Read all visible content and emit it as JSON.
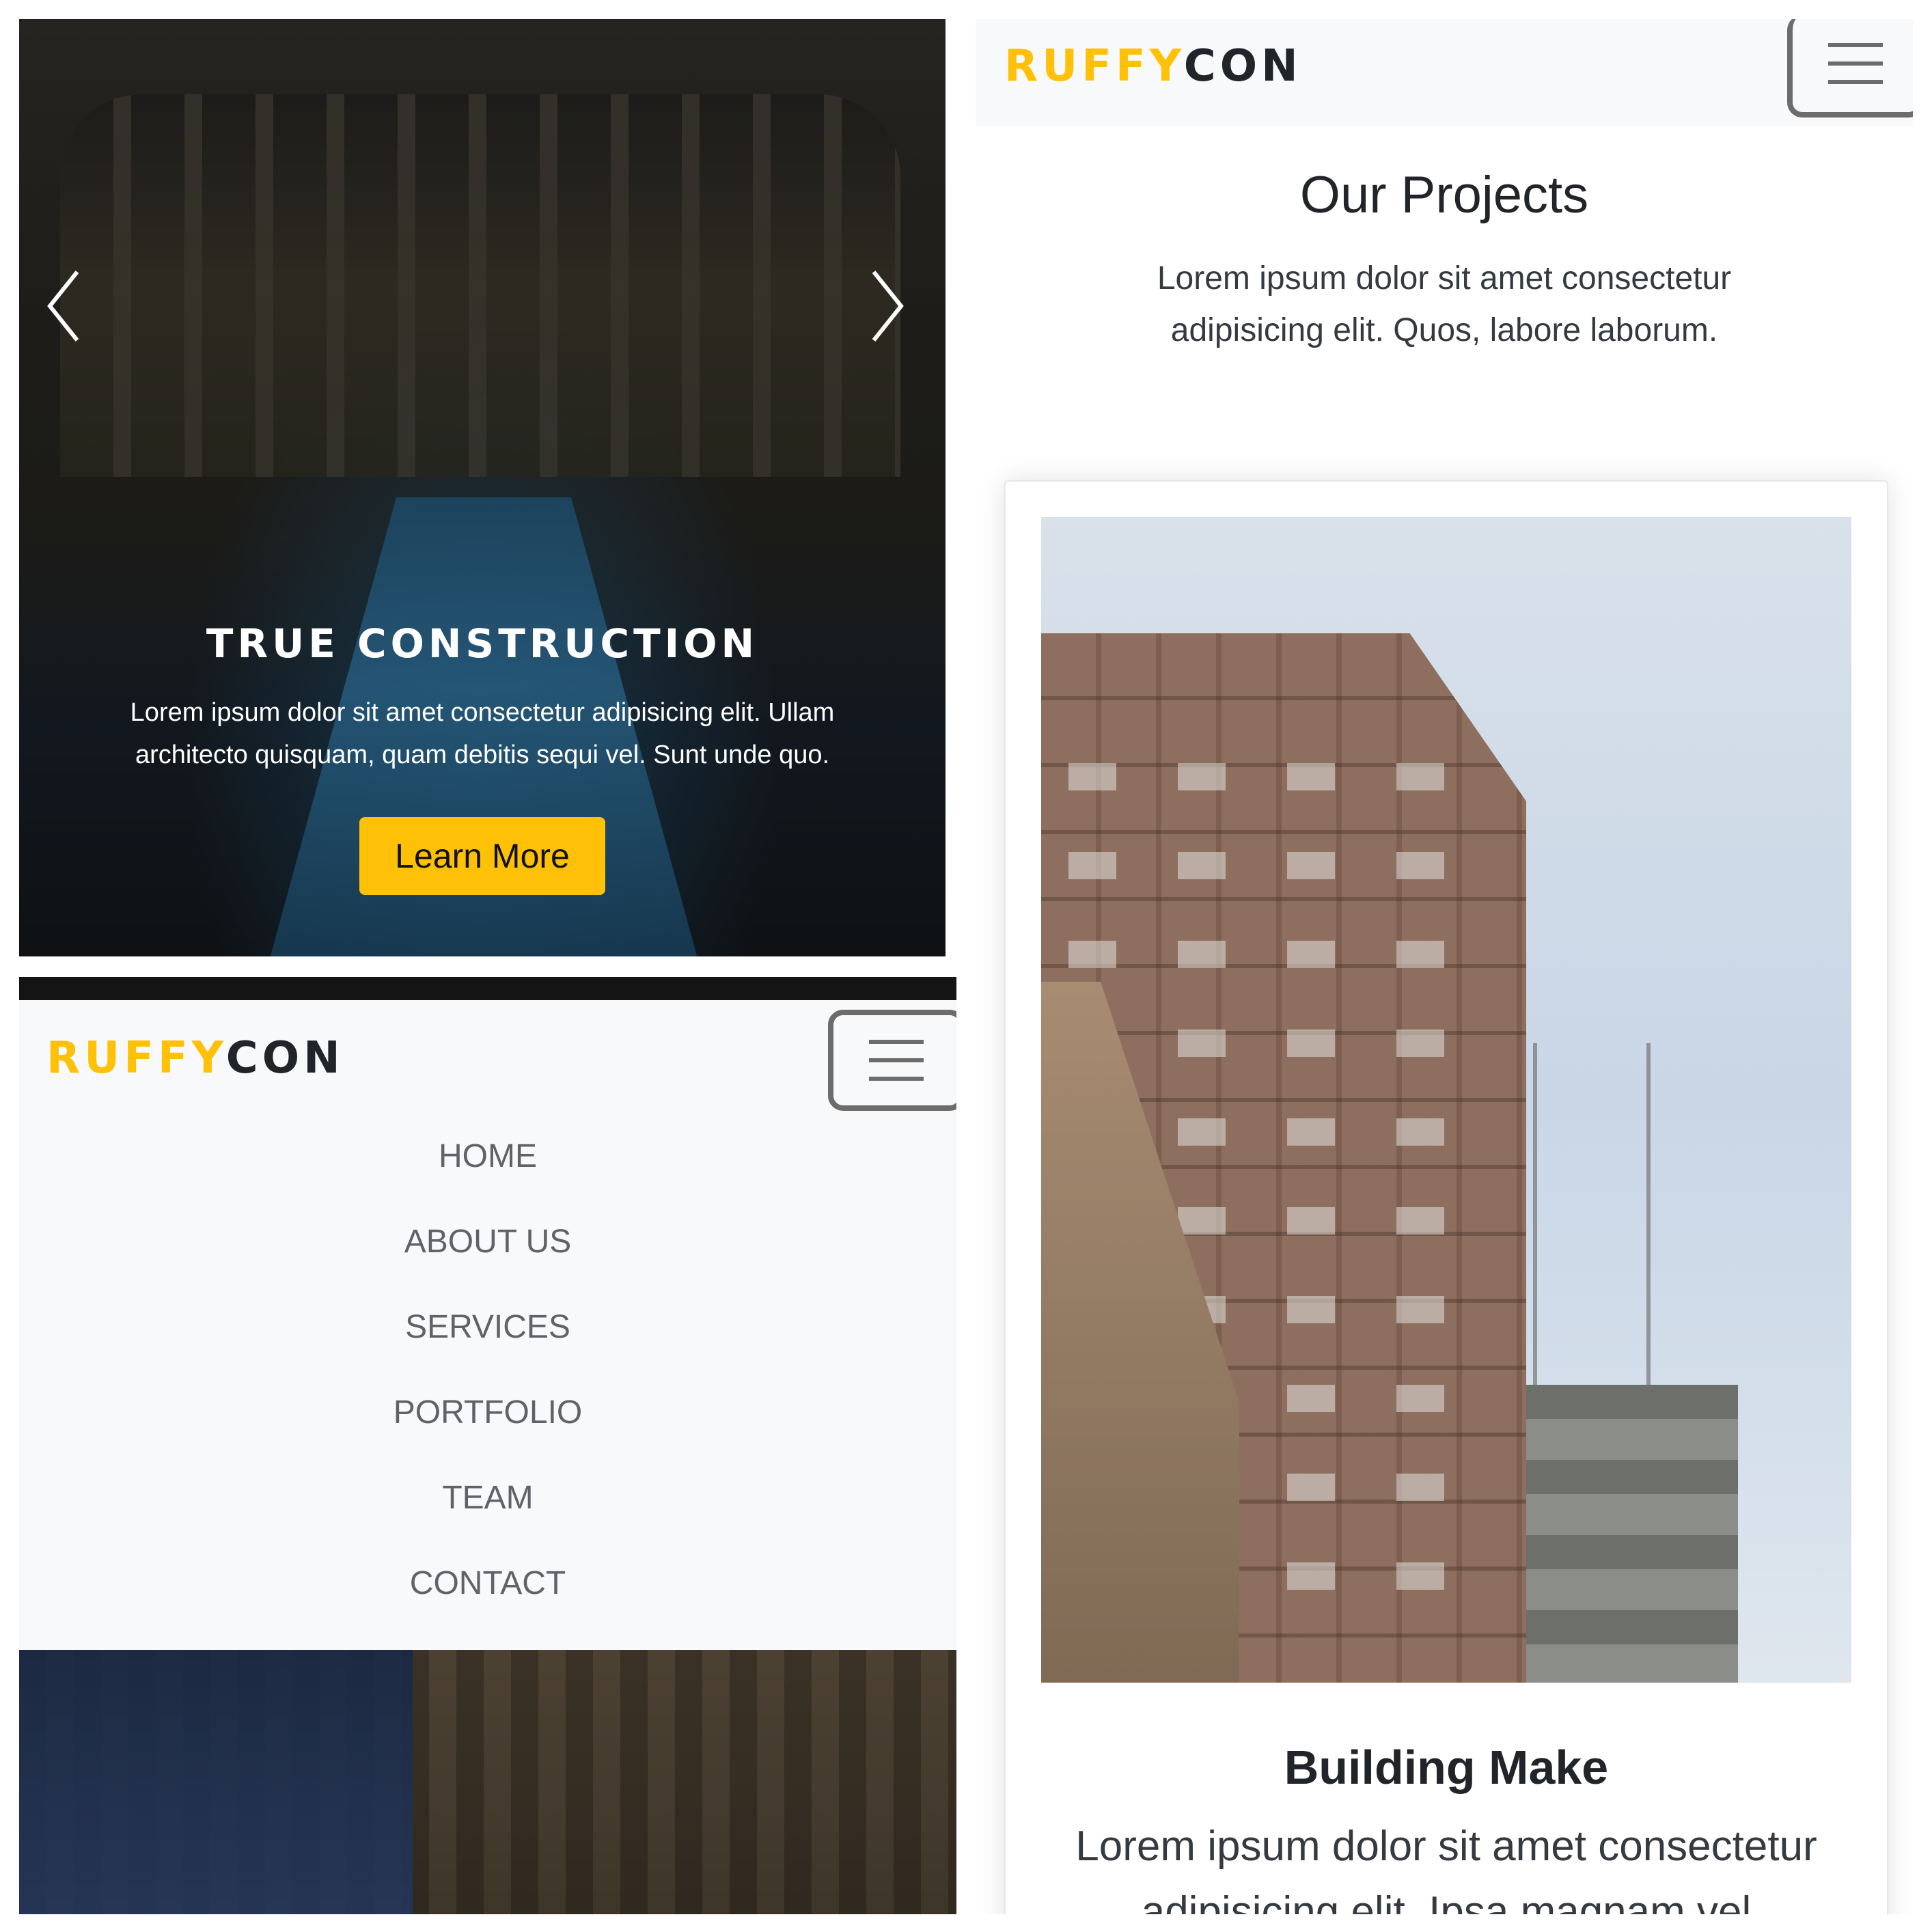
{
  "hero": {
    "title": "TRUE CONSTRUCTION",
    "text": "Lorem ipsum dolor sit amet consectetur adipisicing elit. Ullam architecto quisquam, quam debitis sequi vel. Sunt unde quo.",
    "button_label": "Learn More",
    "prev_icon": "chevron-left-icon",
    "next_icon": "chevron-right-icon"
  },
  "brand": {
    "part1": "RUFFY",
    "part2": "CON",
    "accent": "#ffc107"
  },
  "nav": {
    "toggler_icon": "hamburger-icon",
    "items": [
      {
        "label": "HOME"
      },
      {
        "label": "ABOUT US"
      },
      {
        "label": "SERVICES"
      },
      {
        "label": "PORTFOLIO"
      },
      {
        "label": "TEAM"
      },
      {
        "label": "CONTACT"
      }
    ]
  },
  "projects": {
    "title": "Our Projects",
    "description": "Lorem ipsum dolor sit amet consectetur adipisicing elit. Quos, labore laborum.",
    "card": {
      "title": "Building Make",
      "text": "Lorem ipsum dolor sit amet consectetur adipisicing elit. Ipsa magnam vel"
    }
  }
}
